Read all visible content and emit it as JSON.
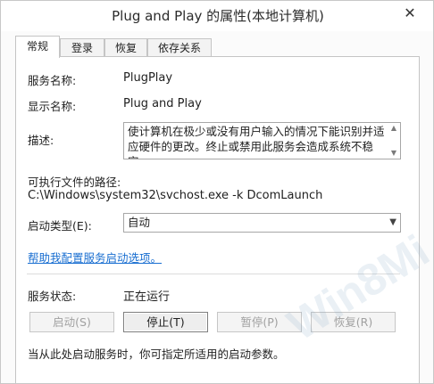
{
  "window": {
    "title": "Plug and Play 的属性(本地计算机)",
    "close_icon": "✕"
  },
  "tabs": [
    {
      "label": "常规",
      "active": true
    },
    {
      "label": "登录",
      "active": false
    },
    {
      "label": "恢复",
      "active": false
    },
    {
      "label": "依存关系",
      "active": false
    }
  ],
  "general": {
    "service_name_label": "服务名称:",
    "service_name_value": "PlugPlay",
    "display_name_label": "显示名称:",
    "display_name_value": "Plug and Play",
    "description_label": "描述:",
    "description_value": "使计算机在极少或没有用户输入的情况下能识别并适应硬件的更改。终止或禁用此服务会造成系统不稳定。",
    "exe_path_label": "可执行文件的路径:",
    "exe_path_value": "C:\\Windows\\system32\\svchost.exe -k DcomLaunch",
    "startup_type_label": "启动类型(E):",
    "startup_type_value": "自动",
    "help_link": "帮助我配置服务启动选项。",
    "status_label": "服务状态:",
    "status_value": "正在运行",
    "buttons": {
      "start": "启动(S)",
      "stop": "停止(T)",
      "pause": "暂停(P)",
      "resume": "恢复(R)"
    },
    "note": "当从此处启动服务时，你可指定所适用的启动参数。"
  },
  "watermark": "Win8Mi"
}
